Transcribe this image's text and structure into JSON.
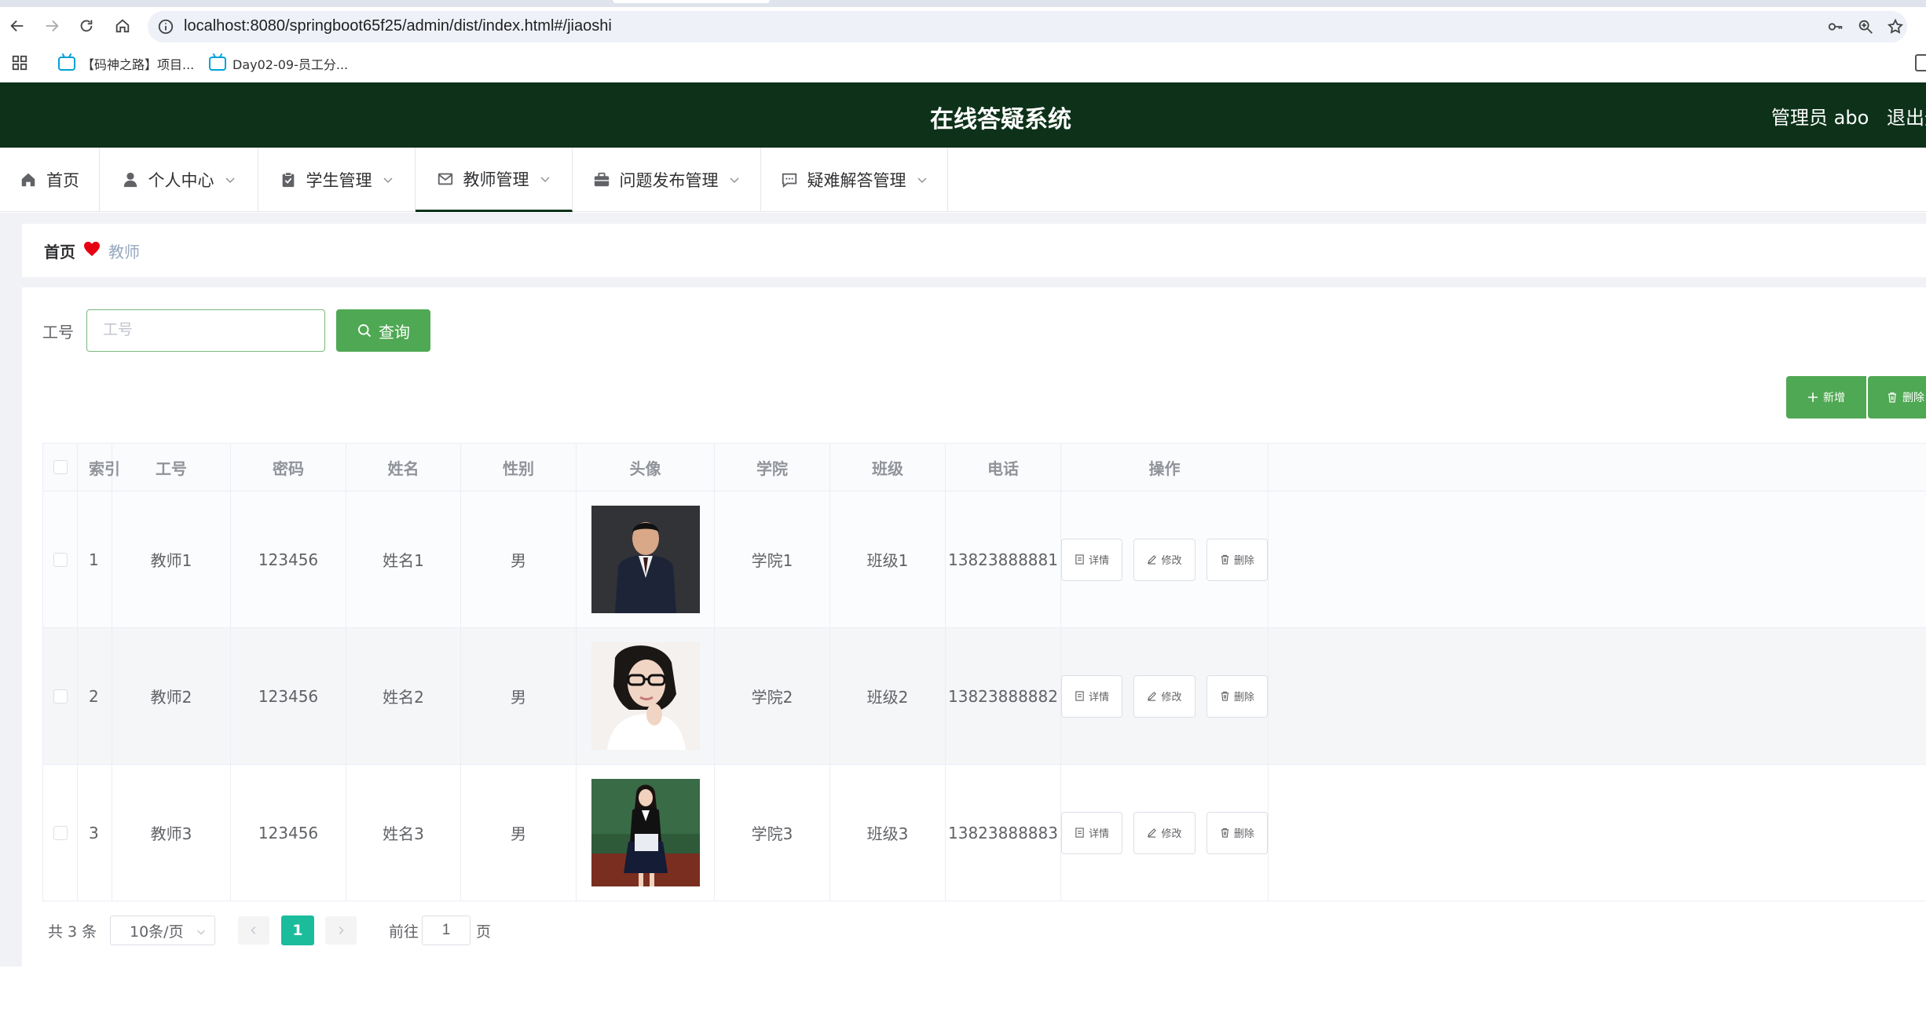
{
  "browser": {
    "url": "localhost:8080/springboot65f25/admin/dist/index.html#/jiaoshi",
    "bookmarks": [
      {
        "label": "【码神之路】项目..."
      },
      {
        "label": "Day02-09-员工分..."
      }
    ]
  },
  "header": {
    "title": "在线答疑系统",
    "admin": "管理员 abo",
    "logout": "退出登录"
  },
  "menu": [
    {
      "label": "首页",
      "icon": "home-icon"
    },
    {
      "label": "个人中心",
      "icon": "user-icon"
    },
    {
      "label": "学生管理",
      "icon": "clipboard-icon"
    },
    {
      "label": "教师管理",
      "icon": "mail-icon"
    },
    {
      "label": "问题发布管理",
      "icon": "briefcase-icon"
    },
    {
      "label": "疑难解答管理",
      "icon": "chat-icon"
    }
  ],
  "breadcrumb": {
    "home": "首页",
    "current": "教师"
  },
  "search": {
    "label": "工号",
    "placeholder": "工号",
    "value": "",
    "button": "查询"
  },
  "actions": {
    "add": "新增",
    "delete": "删除"
  },
  "table": {
    "columns": [
      "索引",
      "工号",
      "密码",
      "姓名",
      "性别",
      "头像",
      "学院",
      "班级",
      "电话",
      "操作"
    ],
    "rows": [
      {
        "index": "1",
        "id": "教师1",
        "password": "123456",
        "name": "姓名1",
        "gender": "男",
        "avatar": "man-in-suit-photo",
        "college": "学院1",
        "class": "班级1",
        "phone": "13823888881"
      },
      {
        "index": "2",
        "id": "教师2",
        "password": "123456",
        "name": "姓名2",
        "gender": "男",
        "avatar": "woman-with-glasses-photo",
        "college": "学院2",
        "class": "班级2",
        "phone": "13823888882"
      },
      {
        "index": "3",
        "id": "教师3",
        "password": "123456",
        "name": "姓名3",
        "gender": "男",
        "avatar": "woman-teacher-at-blackboard-photo",
        "college": "学院3",
        "class": "班级3",
        "phone": "13823888883"
      }
    ],
    "row_actions": {
      "detail": "详情",
      "edit": "修改",
      "delete": "删除"
    }
  },
  "pagination": {
    "total": "共 3 条",
    "page_size": "10条/页",
    "current": "1",
    "goto_prefix": "前往",
    "goto_value": "1",
    "goto_suffix": "页"
  },
  "colors": {
    "header_bg": "#0d3219",
    "primary_button": "#4fa853",
    "active_page": "#1abc9c",
    "breadcrumb_heart": "#e60012"
  }
}
